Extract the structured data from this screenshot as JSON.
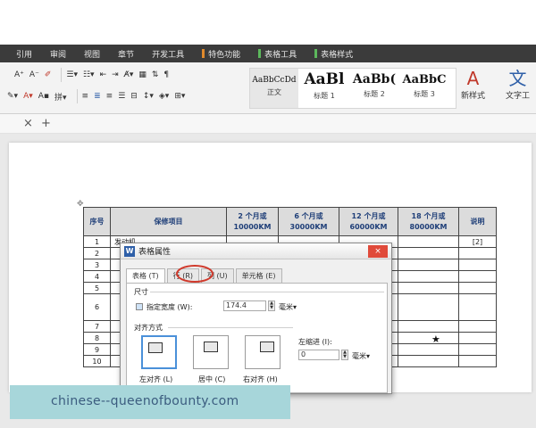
{
  "menu": {
    "items": [
      {
        "label": "引用",
        "accent": ""
      },
      {
        "label": "审阅",
        "accent": ""
      },
      {
        "label": "视图",
        "accent": ""
      },
      {
        "label": "章节",
        "accent": ""
      },
      {
        "label": "开发工具",
        "accent": ""
      },
      {
        "label": "特色功能",
        "accent": "orange"
      },
      {
        "label": "表格工具",
        "accent": "green"
      },
      {
        "label": "表格样式",
        "accent": "green"
      }
    ]
  },
  "ribbon": {
    "font_grow": "A⁺",
    "font_shrink": "A⁻",
    "styles": [
      {
        "sample": "AaBbCcDd",
        "label": "正文"
      },
      {
        "sample": "AaBl",
        "label": "标题 1"
      },
      {
        "sample": "AaBb(",
        "label": "标题 2"
      },
      {
        "sample": "AaBbC",
        "label": "标题 3"
      }
    ],
    "new_style": "新样式",
    "text_tool": "文字工"
  },
  "tabstrip": {
    "close": "×",
    "add": "+"
  },
  "table": {
    "headers": [
      "序号",
      "保修项目",
      "2 个月或\n10000KM",
      "6 个月或\n30000KM",
      "12 个月或\n60000KM",
      "18 个月或\n80000KM",
      "说明"
    ],
    "row_numbers": [
      "1",
      "2",
      "3",
      "4",
      "5",
      "6",
      "7",
      "8",
      "9",
      "10"
    ],
    "row1_text": "发动机……",
    "ref_mark": "[2]",
    "star": "★"
  },
  "dialog": {
    "title": "表格属性",
    "tabs": [
      "表格 (T)",
      "行 (R)",
      "列 (U)",
      "单元格 (E)"
    ],
    "active_tab": "表格 (T)",
    "highlighted_tab": "行 (R)",
    "size_section": "尺寸",
    "width_label": "指定宽度 (W):",
    "width_value": "174.4",
    "width_unit": "毫米",
    "align_section": "对齐方式",
    "indent_label": "左缩进 (I):",
    "indent_value": "0",
    "indent_unit": "毫米",
    "align_options": [
      "左对齐 (L)",
      "居中 (C)",
      "右对齐 (H)"
    ],
    "close_glyph": "×",
    "app_glyph": "W"
  },
  "watermark": {
    "text": "chinese--queenofbounty.com"
  },
  "colors": {
    "menubar": "#3b3b3b",
    "header_text": "#1e3e78",
    "circle": "#d0392b",
    "watermark": "#a7d6da"
  }
}
